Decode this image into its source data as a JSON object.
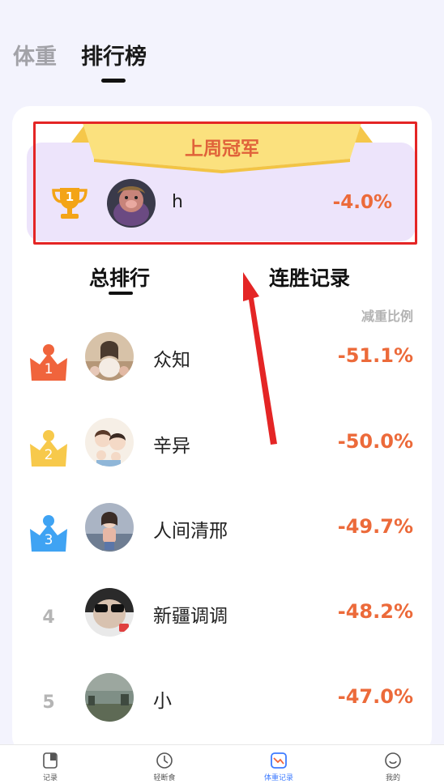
{
  "top_tabs": {
    "weight": "体重",
    "leaderboard": "排行榜"
  },
  "champion": {
    "banner": "上周冠军",
    "rank": "1",
    "name": "h",
    "percent": "-4.0%"
  },
  "sub_tabs": {
    "total": "总排行",
    "streak": "连胜记录"
  },
  "column_header": "减重比例",
  "rankings": [
    {
      "rank": "1",
      "name": "众知",
      "percent": "-51.1%",
      "crown_color": "#f0643c"
    },
    {
      "rank": "2",
      "name": "辛异",
      "percent": "-50.0%",
      "crown_color": "#f7c94b"
    },
    {
      "rank": "3",
      "name": "人间清邢",
      "percent": "-49.7%",
      "crown_color": "#3fa3f3"
    },
    {
      "rank": "4",
      "name": "新疆调调",
      "percent": "-48.2%"
    },
    {
      "rank": "5",
      "name": "小",
      "percent": "-47.0%"
    }
  ],
  "bottom_nav": [
    {
      "label": "记录",
      "icon": "record-icon"
    },
    {
      "label": "轻断食",
      "icon": "clock-icon"
    },
    {
      "label": "体重记录",
      "icon": "weight-chart-icon",
      "active": true
    },
    {
      "label": "我的",
      "icon": "smile-icon"
    }
  ],
  "colors": {
    "accent": "#ec6a3a",
    "nav_active": "#3e7bff",
    "annotation": "#e42525"
  }
}
